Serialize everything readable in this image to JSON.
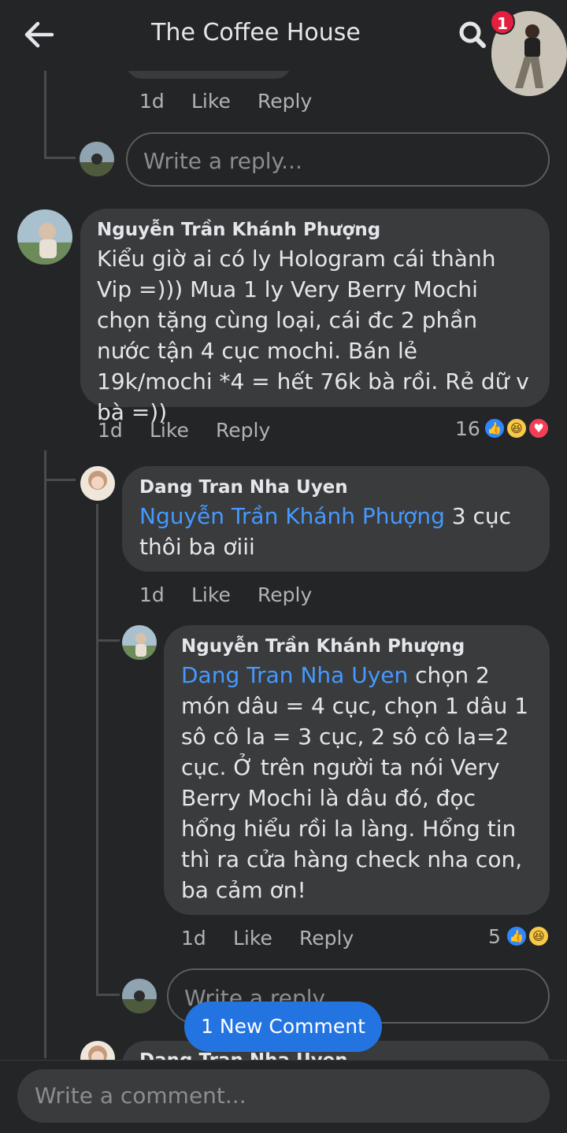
{
  "header": {
    "title": "The Coffee House",
    "chat_badge": "1"
  },
  "top_fragment": {
    "time": "1d",
    "like": "Like",
    "reply": "Reply",
    "input_placeholder": "Write a reply..."
  },
  "comment1": {
    "author": "Nguyễn Trần Khánh Phượng",
    "text": "Kiểu giờ ai có ly Hologram cái thành Vip =))) Mua 1 ly Very Berry Mochi chọn tặng cùng loại, cái đc 2 phần nước tận 4 cục mochi. Bán lẻ 19k/mochi *4 = hết 76k bà rồi. Rẻ dữ v bà =))",
    "time": "1d",
    "like": "Like",
    "reply": "Reply",
    "reaction_count": "16"
  },
  "reply1": {
    "author": "Dang Tran Nha Uyen",
    "mention": "Nguyễn Trần Khánh Phượng",
    "text": " 3 cục thôi ba ơiii",
    "time": "1d",
    "like": "Like",
    "reply": "Reply"
  },
  "reply2": {
    "author": "Nguyễn Trần Khánh Phượng",
    "mention": "Dang Tran Nha Uyen",
    "text": " chọn 2 món dâu = 4 cục, chọn 1 dâu 1 sô cô la = 3 cục, 2 sô cô la=2 cục. Ở trên người ta nói Very Berry Mochi là dâu đó, đọc hổng hiểu rồi la làng. Hổng tin thì ra cửa hàng check nha con, ba cảm ơn!",
    "time": "1d",
    "like": "Like",
    "reply": "Reply",
    "reaction_count": "5"
  },
  "reply_input": {
    "placeholder": "Write a reply..."
  },
  "partial_next": {
    "author": "Dang Tran Nha Uyen"
  },
  "new_comment_button": "1 New Comment",
  "comment_input": {
    "placeholder": "Write a comment..."
  },
  "colors": {
    "background": "#242526",
    "bubble": "#3a3b3c",
    "mention": "#4599ff",
    "button": "#2374e1",
    "badge": "#e41e3f"
  }
}
